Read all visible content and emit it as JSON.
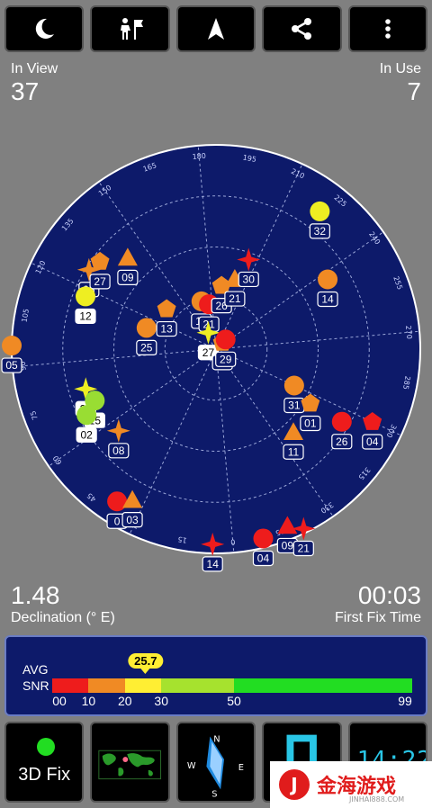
{
  "toolbar": {
    "buttons": [
      {
        "name": "night-mode-button",
        "icon": "moon-icon"
      },
      {
        "name": "mode-button",
        "icon": "person-flag-icon"
      },
      {
        "name": "navigate-button",
        "icon": "navigation-arrow-icon"
      },
      {
        "name": "share-button",
        "icon": "share-icon"
      },
      {
        "name": "menu-button",
        "icon": "more-vert-icon"
      }
    ]
  },
  "stats": {
    "in_view_label": "In View",
    "in_view_value": "37",
    "in_use_label": "In Use",
    "in_use_value": "7",
    "declination_value": "1.48",
    "declination_label": "Declination (° E)",
    "first_fix_value": "00:03",
    "first_fix_label": "First Fix Time"
  },
  "skyplot": {
    "colors": {
      "background": "#0d1a6a",
      "ring": "#ffffff"
    },
    "azimuth_labels": [
      "0",
      "15",
      "30",
      "45",
      "60",
      "75",
      "90",
      "105",
      "120",
      "135",
      "150",
      "165",
      "180",
      "195",
      "210",
      "225",
      "240",
      "255",
      "270",
      "285",
      "300",
      "315",
      "330",
      "345"
    ],
    "rotation_deg": 175,
    "satellites": [
      {
        "id": "18",
        "shape": "circle",
        "color": "#f08a24",
        "used": false,
        "az": 168,
        "el": 68
      },
      {
        "id": "21",
        "shape": "circle",
        "color": "#ee1c1c",
        "used": false,
        "az": 176,
        "el": 70
      },
      {
        "id": "26",
        "shape": "pentagon",
        "color": "#f08a24",
        "used": false,
        "az": 190,
        "el": 62
      },
      {
        "id": "21",
        "shape": "triangle",
        "color": "#f08a24",
        "used": false,
        "az": 200,
        "el": 58
      },
      {
        "id": "30",
        "shape": "star4",
        "color": "#ee1c1c",
        "used": false,
        "az": 205,
        "el": 48
      },
      {
        "id": "32",
        "shape": "circle",
        "color": "#eeee22",
        "used": false,
        "az": 222,
        "el": 14
      },
      {
        "id": "14",
        "shape": "circle",
        "color": "#f08a24",
        "used": false,
        "az": 243,
        "el": 32
      },
      {
        "id": "05",
        "shape": "star4",
        "color": "#f08a24",
        "used": false,
        "az": 127,
        "el": 24
      },
      {
        "id": "27",
        "shape": "pentagon",
        "color": "#f08a24",
        "used": false,
        "az": 132,
        "el": 26
      },
      {
        "id": "09",
        "shape": "triangle",
        "color": "#f08a24",
        "used": false,
        "az": 141,
        "el": 34
      },
      {
        "id": "12",
        "shape": "circle",
        "color": "#eeee22",
        "used": true,
        "az": 117,
        "el": 28
      },
      {
        "id": "05",
        "shape": "circle",
        "color": "#f08a24",
        "used": false,
        "az": 96,
        "el": 0
      },
      {
        "id": "25",
        "shape": "circle",
        "color": "#f08a24",
        "used": false,
        "az": 112,
        "el": 58
      },
      {
        "id": "13",
        "shape": "pentagon",
        "color": "#f08a24",
        "used": false,
        "az": 134,
        "el": 62
      },
      {
        "id": "27",
        "shape": "star4",
        "color": "#eeee22",
        "used": true,
        "az": 160,
        "el": 82
      },
      {
        "id": "21",
        "shape": "pentagon",
        "color": "#f08a24",
        "used": false,
        "az": 230,
        "el": 86
      },
      {
        "id": "29",
        "shape": "circle",
        "color": "#ee1c1c",
        "used": false,
        "az": 230,
        "el": 84
      },
      {
        "id": "31",
        "shape": "circle",
        "color": "#f08a24",
        "used": false,
        "az": 300,
        "el": 52
      },
      {
        "id": "01",
        "shape": "pentagon",
        "color": "#f08a24",
        "used": false,
        "az": 305,
        "el": 42
      },
      {
        "id": "26",
        "shape": "circle",
        "color": "#ee1c1c",
        "used": false,
        "az": 305,
        "el": 26
      },
      {
        "id": "04",
        "shape": "pentagon",
        "color": "#ee1c1c",
        "used": false,
        "az": 300,
        "el": 14
      },
      {
        "id": "11",
        "shape": "triangle",
        "color": "#f08a24",
        "used": false,
        "az": 322,
        "el": 40
      },
      {
        "id": "21",
        "shape": "star4",
        "color": "#eeee22",
        "used": true,
        "az": 78,
        "el": 30
      },
      {
        "id": "15",
        "shape": "circle",
        "color": "#99dd33",
        "used": true,
        "az": 72,
        "el": 32
      },
      {
        "id": "02",
        "shape": "circle",
        "color": "#99dd33",
        "used": true,
        "az": 68,
        "el": 26
      },
      {
        "id": "08",
        "shape": "star4",
        "color": "#f08a24",
        "used": false,
        "az": 55,
        "el": 34
      },
      {
        "id": "0",
        "shape": "circle",
        "color": "#ee1c1c",
        "used": false,
        "az": 38,
        "el": 10
      },
      {
        "id": "03",
        "shape": "triangle",
        "color": "#f08a24",
        "used": false,
        "az": 34,
        "el": 14
      },
      {
        "id": "14",
        "shape": "star4",
        "color": "#ee1c1c",
        "used": false,
        "az": 6,
        "el": 4
      },
      {
        "id": "04",
        "shape": "circle",
        "color": "#ee1c1c",
        "used": false,
        "az": 351,
        "el": 4
      },
      {
        "id": "09",
        "shape": "triangle",
        "color": "#ee1c1c",
        "used": false,
        "az": 343,
        "el": 6
      },
      {
        "id": "21",
        "shape": "star4",
        "color": "#ee1c1c",
        "used": false,
        "az": 339,
        "el": 2
      }
    ]
  },
  "snr": {
    "avg_label": "AVG",
    "snr_label": "SNR",
    "avg_value": "25.7",
    "max": 99,
    "ticks": [
      "00",
      "10",
      "20",
      "30",
      "50",
      "99"
    ],
    "segments": [
      {
        "from": 0,
        "to": 10,
        "color": "#ee1c1c"
      },
      {
        "from": 10,
        "to": 20,
        "color": "#f08a24"
      },
      {
        "from": 20,
        "to": 30,
        "color": "#ffee33"
      },
      {
        "from": 30,
        "to": 50,
        "color": "#a6e22e"
      },
      {
        "from": 50,
        "to": 99,
        "color": "#22dd22"
      }
    ]
  },
  "bottom": {
    "fix_label": "3D Fix",
    "clock_text": "14:22"
  },
  "watermark": {
    "logo_char": "J",
    "text": "金海游戏",
    "sub": "JINHAI888.COM"
  }
}
